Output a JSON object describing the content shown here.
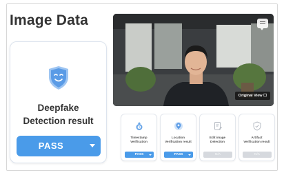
{
  "title": "Image Data",
  "result": {
    "label_line1": "Deepfake",
    "label_line2": "Detection result",
    "status": "PASS"
  },
  "video": {
    "original_view_label": "Original View ☐"
  },
  "checks": [
    {
      "line1": "Timestamp",
      "line2": "Verification",
      "status": "PASS",
      "active": true
    },
    {
      "line1": "Location",
      "line2": "Verification result",
      "status": "PASS",
      "active": true
    },
    {
      "line1": "Edit image",
      "line2": "Detection",
      "status": "N/A",
      "active": false
    },
    {
      "line1": "Artifact",
      "line2": "Verification result",
      "status": "N/A",
      "active": false
    }
  ],
  "colors": {
    "accent": "#4a9be9",
    "shield": "#6aa6e8"
  }
}
